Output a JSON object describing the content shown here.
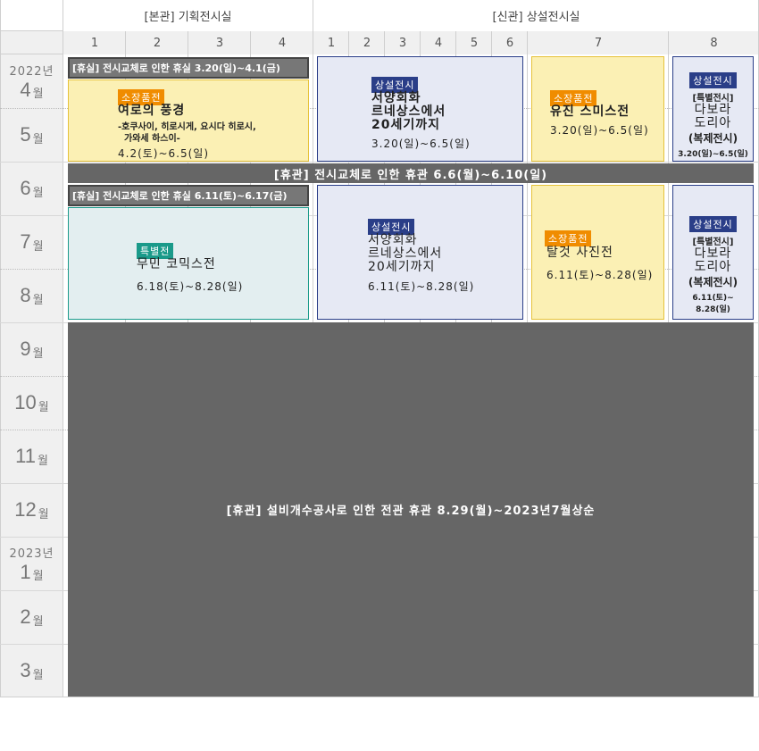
{
  "headers": {
    "main_hall": "[본관] 기획전시실",
    "new_hall": "[신관] 상설전시실"
  },
  "columns": [
    "1",
    "2",
    "3",
    "4",
    "1",
    "2",
    "3",
    "4",
    "5",
    "6",
    "7",
    "8"
  ],
  "rows": [
    {
      "year": "2022년",
      "month": "4",
      "unit": "월"
    },
    {
      "month": "5",
      "unit": "월"
    },
    {
      "month": "6",
      "unit": "월"
    },
    {
      "month": "7",
      "unit": "월"
    },
    {
      "month": "8",
      "unit": "월"
    },
    {
      "month": "9",
      "unit": "월"
    },
    {
      "month": "10",
      "unit": "월"
    },
    {
      "month": "11",
      "unit": "월"
    },
    {
      "month": "12",
      "unit": "월"
    },
    {
      "year": "2023년",
      "month": "1",
      "unit": "월"
    },
    {
      "month": "2",
      "unit": "월"
    },
    {
      "month": "3",
      "unit": "월"
    }
  ],
  "closures": {
    "closure1": "[휴실] 전시교체로 인한 휴실 3.20(일)~4.1(금)",
    "closure2": "[휴관] 전시교체로 인한 휴관  6.6(월)~6.10(일)",
    "closure3": "[휴실] 전시교체로 인한 휴실 6.11(토)~6.17(금)",
    "closure_big": "[휴관] 설비개수공사로 인한 전관 휴관  8.29(월)~2023년7월상순"
  },
  "exhibitions": {
    "e1": {
      "tag": "소장품전",
      "title": "여로의 풍경",
      "subtitle1": "-호쿠사이, 히로시게, 요시다 히로시,",
      "subtitle2": "가와세 하스이-",
      "date": "4.2(토)~6.5(일)"
    },
    "e2": {
      "tag": "상설전시",
      "title1": "서양회화",
      "title2": "르네상스에서",
      "title3": "20세기까지",
      "date": "3.20(일)~6.5(일)"
    },
    "e3": {
      "tag": "소장품전",
      "title": "유진 스미스전",
      "date": "3.20(일)~6.5(일)"
    },
    "e4": {
      "tag": "상설전시",
      "subtag": "[특별전시]",
      "title1": "다보라",
      "title2": "도리아",
      "title3": "(복제전시)",
      "date": "3.20(일)~6.5(일)"
    },
    "e5": {
      "tag": "특별전",
      "title": "무민 코믹스전",
      "date": "6.18(토)~8.28(일)"
    },
    "e6": {
      "tag": "상설전시",
      "title1": "서양회화",
      "title2": "르네상스에서",
      "title3": "20세기까지",
      "date": "6.11(토)~8.28(일)"
    },
    "e7": {
      "tag": "소장품전",
      "title": "탈것 사진전",
      "date": "6.11(토)~8.28(일)"
    },
    "e8": {
      "tag": "상설전시",
      "subtag": "[특별전시]",
      "title1": "다보라",
      "title2": "도리아",
      "title3": "(복제전시)",
      "date1": "6.11(토)~",
      "date2": "8.28(일)"
    }
  },
  "colors": {
    "orange_tag": "#f08c00",
    "navy_tag": "#2a3e88",
    "teal_tag": "#1a9a8a",
    "closure": "#666666",
    "yellow_box": "#fbf0b4",
    "blue_box": "#e6e9f4",
    "teal_box": "#e3eef0"
  }
}
